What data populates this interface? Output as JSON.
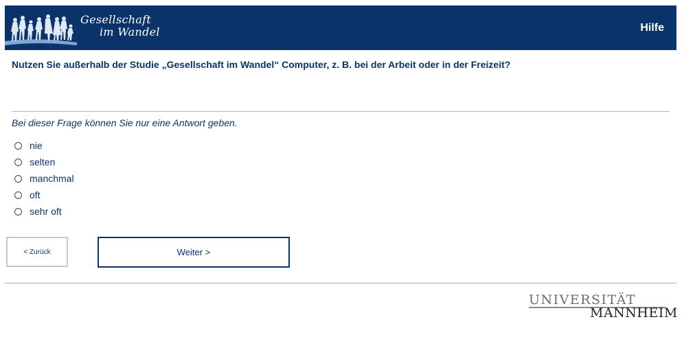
{
  "header": {
    "logo_line1": "Gesellschaft",
    "logo_line2": "im Wandel",
    "help_label": "Hilfe",
    "background_color": "#0a3369"
  },
  "question": {
    "text": "Nutzen Sie außerhalb der Studie „Gesellschaft im Wandel“ Computer, z. B. bei der Arbeit oder in der Freizeit?",
    "instruction": "Bei dieser Frage können Sie nur eine Antwort geben.",
    "options": [
      {
        "label": "nie"
      },
      {
        "label": "selten"
      },
      {
        "label": "manchmal"
      },
      {
        "label": "oft"
      },
      {
        "label": "sehr oft"
      }
    ]
  },
  "navigation": {
    "back_label": "< Zurück",
    "next_label": "Weiter >"
  },
  "footer": {
    "university_line1": "UNIVERSITÄT",
    "university_line2": "MANNHEIM"
  }
}
